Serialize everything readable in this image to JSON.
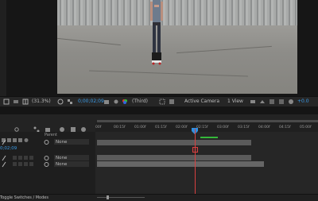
{
  "viewer": {
    "zoom": "(31.3%)",
    "timecode": "0;00;02;09",
    "resolution": "(Third)",
    "camera": "Active Camera",
    "views": "1 View",
    "exposure": "+0.0"
  },
  "timeline": {
    "current_time": "0;02;09",
    "column_header": "Parent",
    "time_ticks": [
      "00f",
      "00:15f",
      "01:00f",
      "01:15f",
      "02:00f",
      "02:15f",
      "03:00f",
      "03:15f",
      "04:00f",
      "04:15f",
      "05:00f"
    ],
    "layers": [
      {
        "parent": "None"
      },
      {
        "parent": "None"
      },
      {
        "parent": "None"
      }
    ]
  },
  "bottom": {
    "toggle_label": "Toggle Switches / Modes"
  },
  "colors": {
    "accent_blue": "#2f8fe0",
    "playhead_red": "#d84040",
    "work_area_green": "#35b83a"
  }
}
